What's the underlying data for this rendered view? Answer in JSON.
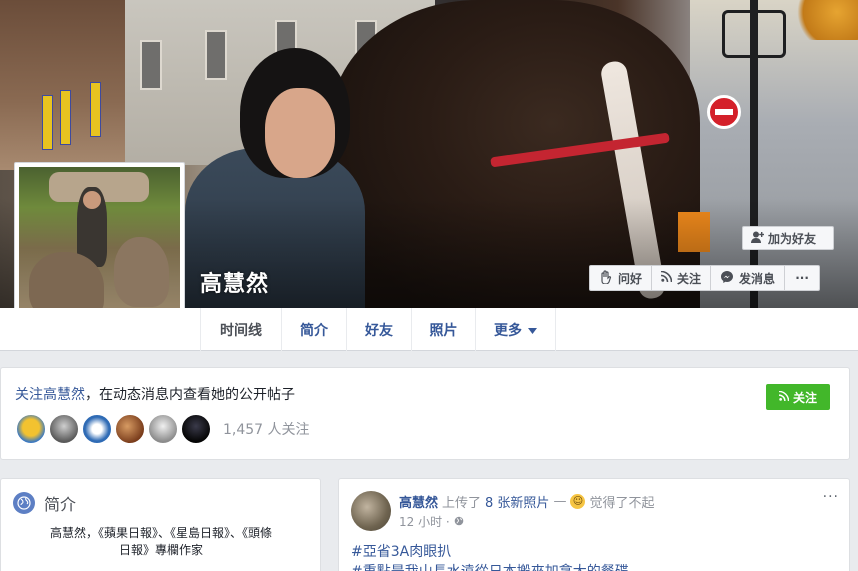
{
  "profile": {
    "name": "高慧然"
  },
  "cover_actions": {
    "add_friend": "加为好友",
    "wave": "问好",
    "follow": "关注",
    "message": "发消息",
    "more": "···"
  },
  "tabs": [
    {
      "label": "时间线",
      "active": true
    },
    {
      "label": "简介"
    },
    {
      "label": "好友"
    },
    {
      "label": "照片"
    },
    {
      "label": "更多"
    }
  ],
  "follow_card": {
    "link": "关注高慧然",
    "text": "，在动态消息内查看她的公开帖子",
    "button": "关注",
    "count": "1,457 人关注",
    "avatar_colors": [
      "#f2c230",
      "#7b7b7b",
      "#2f6bb5",
      "#9b5a2e",
      "#cfcfcf",
      "#111111"
    ]
  },
  "intro": {
    "title": "简介",
    "line1": "高慧然，《蘋果日報》、《星島日報》、《頭條",
    "line2": "日報》專欄作家"
  },
  "post": {
    "author": "高慧然",
    "action": "上传了",
    "photos": "8 张新照片",
    "dash": "—",
    "feeling": "觉得了不起",
    "time": "12 小时 ·",
    "more": "···",
    "hashtag1": "#亞省3A肉眼扒",
    "hashtag2": "#重點是我山長水遠從日本搬來加拿大的餐碟"
  },
  "colors": {
    "link": "#365899",
    "follow_green": "#42b72a",
    "page_bg": "#e9ebee"
  }
}
